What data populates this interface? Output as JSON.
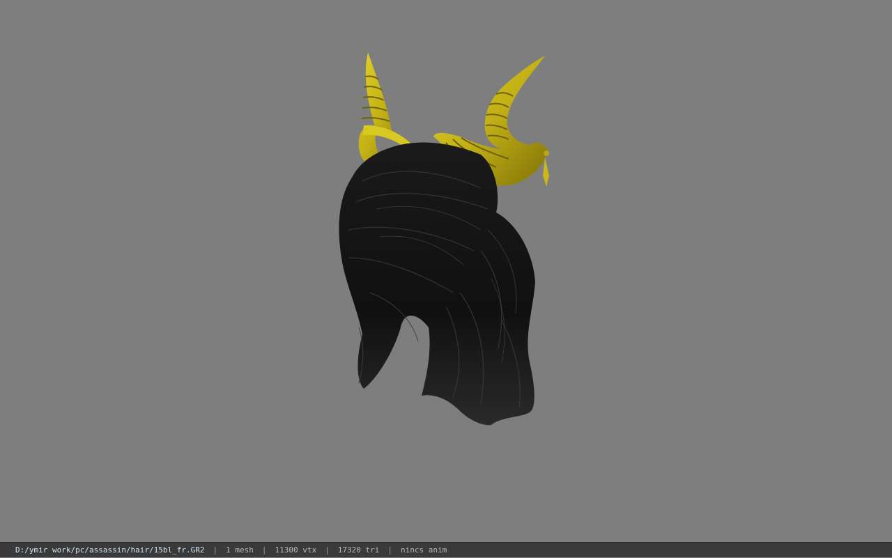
{
  "viewport": {
    "background": "#7e7e7e",
    "model_name": "hair-with-horns-model"
  },
  "colors": {
    "horn": "#c9b81a",
    "horn_dark": "#8c7e0c",
    "hair": "#141414",
    "hair_highlight": "#3c3c3c"
  },
  "statusbar": {
    "file_path": "D:/ymir work/pc/assassin/hair/15bl_fr.GR2",
    "separator": "|",
    "mesh_count": "1 mesh",
    "vertex_count": "11300 vtx",
    "triangle_count": "17320 tri",
    "anim": "nincs anim"
  }
}
